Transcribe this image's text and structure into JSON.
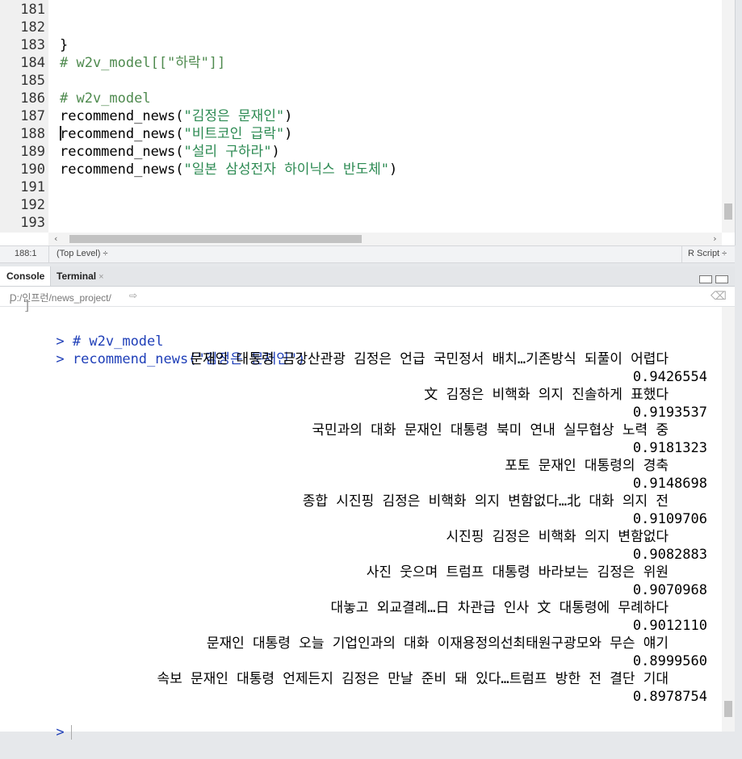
{
  "editor": {
    "lines": [
      {
        "num": "181",
        "parts": []
      },
      {
        "num": "182",
        "parts": []
      },
      {
        "num": "183",
        "parts": [
          {
            "t": "}",
            "c": "fn"
          }
        ]
      },
      {
        "num": "184",
        "parts": [
          {
            "t": "# w2v_model[[\"하락\"]]",
            "c": "cmt"
          }
        ]
      },
      {
        "num": "185",
        "parts": []
      },
      {
        "num": "186",
        "parts": [
          {
            "t": "# w2v_model",
            "c": "cmt"
          }
        ]
      },
      {
        "num": "187",
        "parts": [
          {
            "t": "recommend_news(",
            "c": "fn"
          },
          {
            "t": "\"김정은 문재인\"",
            "c": "str"
          },
          {
            "t": ")",
            "c": "fn"
          }
        ]
      },
      {
        "num": "188",
        "parts": [
          {
            "t": "recommend_news(",
            "c": "fn"
          },
          {
            "t": "\"비트코인 급락\"",
            "c": "str"
          },
          {
            "t": ")",
            "c": "fn"
          }
        ]
      },
      {
        "num": "189",
        "parts": [
          {
            "t": "recommend_news(",
            "c": "fn"
          },
          {
            "t": "\"설리 구하라\"",
            "c": "str"
          },
          {
            "t": ")",
            "c": "fn"
          }
        ]
      },
      {
        "num": "190",
        "parts": [
          {
            "t": "recommend_news(",
            "c": "fn"
          },
          {
            "t": "\"일본 삼성전자 하이닉스 반도체\"",
            "c": "str"
          },
          {
            "t": ")",
            "c": "fn"
          }
        ]
      },
      {
        "num": "191",
        "parts": []
      },
      {
        "num": "192",
        "parts": []
      },
      {
        "num": "193",
        "parts": []
      }
    ]
  },
  "statusbar": {
    "position": "188:1",
    "scope": "(Top Level) ÷",
    "filetype": "R Script ÷"
  },
  "console": {
    "tabs": {
      "console": "Console",
      "terminal": "Terminal",
      "terminal_close": "×"
    },
    "path": "D:/인프런/news_project/",
    "prompt": ">",
    "cut_line": "' ]",
    "commands": [
      "# w2v_model",
      "recommend_news(\"김정은 문재인\")"
    ],
    "results": [
      {
        "title": "문재인 대통령 금강산관광 김정은 언급 국민정서 배치…기존방식 되풀이 어렵다",
        "score": "0.9426554"
      },
      {
        "title": "文 김정은 비핵화 의지 진솔하게 표했다",
        "score": "0.9193537"
      },
      {
        "title": "국민과의 대화 문재인 대통령 북미 연내 실무협상 노력 중",
        "score": "0.9181323"
      },
      {
        "title": "포토 문재인 대통령의 경축",
        "score": "0.9148698"
      },
      {
        "title": "종합 시진핑 김정은 비핵화 의지 변함없다…北 대화 의지 전",
        "score": "0.9109706"
      },
      {
        "title": "시진핑 김정은 비핵화 의지 변함없다",
        "score": "0.9082883"
      },
      {
        "title": "사진 웃으며 트럼프 대통령 바라보는 김정은 위원",
        "score": "0.9070968"
      },
      {
        "title": "대놓고 외교결례…日 차관급 인사 文 대통령에 무례하다",
        "score": "0.9012110"
      },
      {
        "title": "문재인 대통령 오늘 기업인과의 대화 이재용정의선최태원구광모와 무슨 얘기",
        "score": "0.8999560"
      },
      {
        "title": "속보 문재인 대통령 언제든지 김정은 만날 준비 돼 있다…트럼프 방한 전 결단 기대",
        "score": "0.8978754"
      }
    ]
  }
}
